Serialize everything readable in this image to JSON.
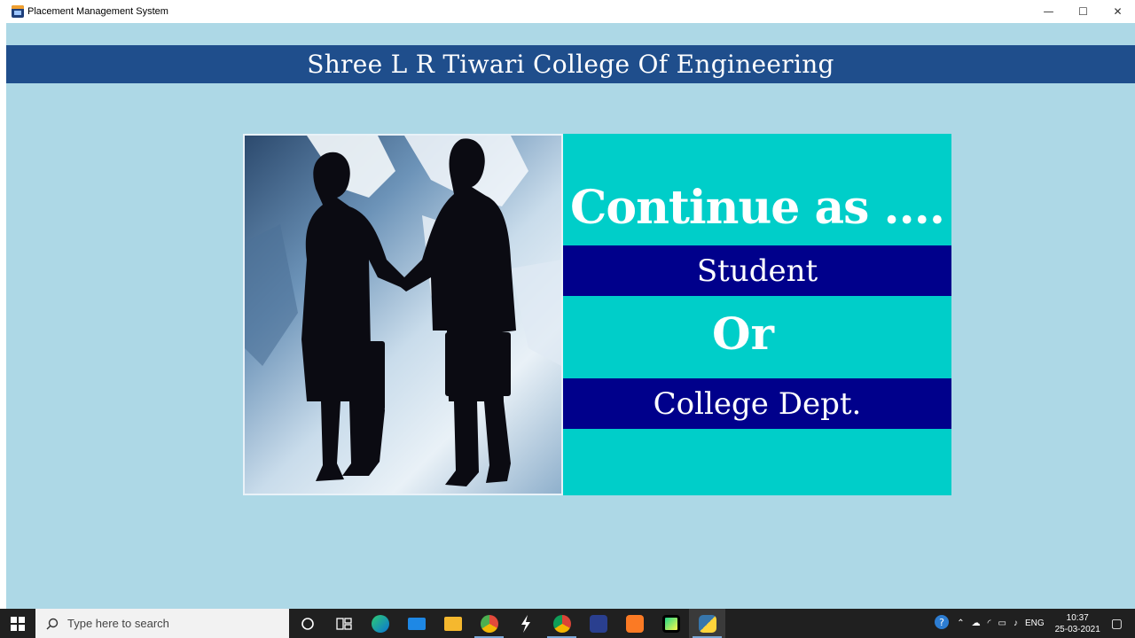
{
  "window": {
    "title": "Placement Management System",
    "controls": {
      "minimize": "—",
      "maximize": "☐",
      "close": "✕"
    }
  },
  "header": {
    "college_name": "Shree L R Tiwari College Of Engineering"
  },
  "choice": {
    "heading": "Continue as ....",
    "option_student": "Student",
    "separator": "Or",
    "option_college": "College Dept."
  },
  "taskbar": {
    "search_placeholder": "Type here to search",
    "apps": [
      {
        "name": "cortana-icon"
      },
      {
        "name": "task-view-icon"
      },
      {
        "name": "edge-icon"
      },
      {
        "name": "mail-icon"
      },
      {
        "name": "file-explorer-icon"
      },
      {
        "name": "chrome-canary-icon"
      },
      {
        "name": "git-bash-icon"
      },
      {
        "name": "chrome-icon"
      },
      {
        "name": "dev-cpp-icon"
      },
      {
        "name": "xampp-icon"
      },
      {
        "name": "pycharm-icon"
      },
      {
        "name": "python-icon"
      }
    ],
    "tray": {
      "language": "ENG",
      "time": "10:37",
      "date": "25-03-2021"
    }
  },
  "colors": {
    "window_bg": "#add8e6",
    "header_band": "#1f4e8c",
    "choice_bg": "#00cec9",
    "option_band": "#00008b"
  }
}
